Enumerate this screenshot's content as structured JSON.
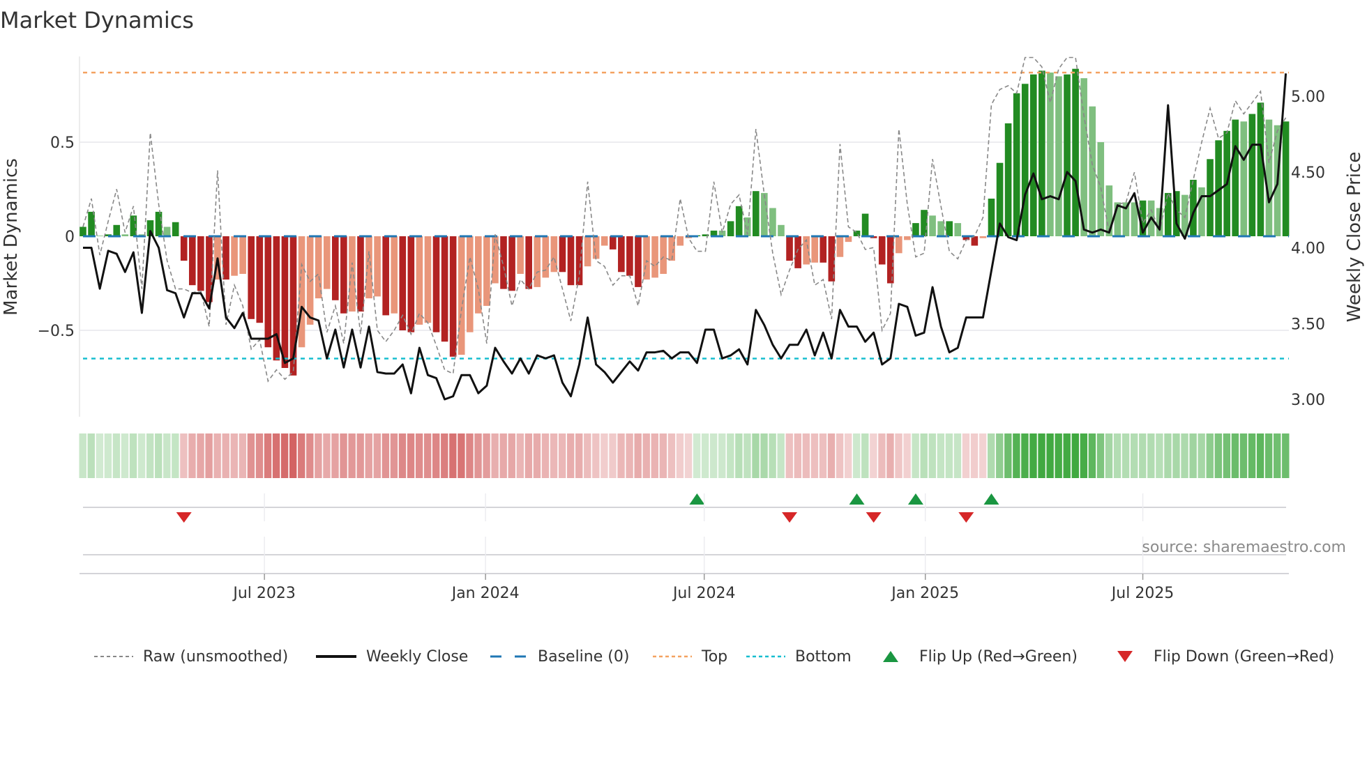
{
  "chart_data": {
    "type": "bar",
    "title": "Market Dynamics",
    "ylabel": "Market Dynamics",
    "y2label": "Weekly Close Price",
    "ylim": [
      -0.955,
      0.955
    ],
    "y2lim": [
      2.9,
      5.25
    ],
    "yticks": [
      {
        "v": 0.5,
        "label": "0.5"
      },
      {
        "v": 0,
        "label": "0"
      },
      {
        "v": -0.5,
        "label": "−0.5"
      }
    ],
    "y2ticks": [
      {
        "v": 5.0,
        "label": "5.00"
      },
      {
        "v": 4.5,
        "label": "4.50"
      },
      {
        "v": 4.0,
        "label": "4.00"
      },
      {
        "v": 3.5,
        "label": "3.50"
      },
      {
        "v": 3.0,
        "label": "3.00"
      }
    ],
    "xticks": [
      {
        "date": "2023-07-01",
        "label": "Jul 2023"
      },
      {
        "date": "2024-01-01",
        "label": "Jan 2024"
      },
      {
        "date": "2024-07-01",
        "label": "Jul 2024"
      },
      {
        "date": "2025-01-01",
        "label": "Jan 2025"
      },
      {
        "date": "2025-07-01",
        "label": "Jul 2025"
      }
    ],
    "start_date": "2023-01-31",
    "frequency": "weekly",
    "top_level": 0.87,
    "bottom_level": -0.65,
    "baseline": 0,
    "momentum": [
      0.05,
      0.13,
      0.003,
      0.01,
      0.06,
      0.01,
      0.11,
      0.01,
      0.085,
      0.13,
      0.05,
      0.075,
      -0.13,
      -0.26,
      -0.29,
      -0.35,
      -0.23,
      -0.23,
      -0.21,
      -0.2,
      -0.44,
      -0.46,
      -0.59,
      -0.66,
      -0.7,
      -0.74,
      -0.59,
      -0.47,
      -0.33,
      -0.28,
      -0.34,
      -0.41,
      -0.4,
      -0.4,
      -0.33,
      -0.32,
      -0.42,
      -0.41,
      -0.5,
      -0.51,
      -0.47,
      -0.46,
      -0.51,
      -0.56,
      -0.64,
      -0.63,
      -0.51,
      -0.41,
      -0.37,
      -0.25,
      -0.28,
      -0.29,
      -0.2,
      -0.28,
      -0.27,
      -0.22,
      -0.19,
      -0.19,
      -0.26,
      -0.26,
      -0.16,
      -0.12,
      -0.05,
      -0.07,
      -0.19,
      -0.21,
      -0.27,
      -0.23,
      -0.22,
      -0.2,
      -0.13,
      -0.05,
      -0.01,
      0.005,
      0.01,
      0.03,
      0.03,
      0.08,
      0.16,
      0.1,
      0.24,
      0.23,
      0.15,
      0.06,
      -0.13,
      -0.17,
      -0.15,
      -0.14,
      -0.14,
      -0.24,
      -0.11,
      -0.03,
      0.03,
      0.12,
      -0.01,
      -0.15,
      -0.25,
      -0.09,
      -0.02,
      0.07,
      0.14,
      0.11,
      0.08,
      0.08,
      0.07,
      -0.02,
      -0.05,
      -0.01,
      0.2,
      0.39,
      0.6,
      0.76,
      0.81,
      0.86,
      0.88,
      0.87,
      0.85,
      0.86,
      0.89,
      0.84,
      0.69,
      0.5,
      0.27,
      0.18,
      0.18,
      0.18,
      0.19,
      0.19,
      0.15,
      0.23,
      0.24,
      0.22,
      0.3,
      0.26,
      0.41,
      0.51,
      0.56,
      0.62,
      0.61,
      0.65,
      0.71,
      0.62,
      0.59,
      0.61
    ],
    "strong": [
      1,
      1,
      0,
      1,
      1,
      0,
      1,
      0,
      1,
      1,
      0,
      1,
      1,
      1,
      1,
      1,
      0,
      1,
      0,
      0,
      1,
      1,
      1,
      1,
      1,
      1,
      0,
      0,
      0,
      0,
      1,
      1,
      0,
      1,
      0,
      0,
      1,
      0,
      1,
      1,
      0,
      0,
      1,
      1,
      1,
      0,
      0,
      0,
      0,
      0,
      1,
      1,
      0,
      1,
      0,
      0,
      0,
      1,
      1,
      1,
      0,
      0,
      0,
      1,
      1,
      1,
      1,
      0,
      0,
      0,
      0,
      0,
      0,
      1,
      1,
      1,
      0,
      1,
      1,
      0,
      1,
      0,
      0,
      0,
      1,
      1,
      0,
      0,
      1,
      1,
      0,
      0,
      1,
      1,
      1,
      1,
      1,
      0,
      0,
      1,
      1,
      0,
      0,
      1,
      0,
      1,
      1,
      0,
      1,
      1,
      1,
      1,
      1,
      1,
      1,
      0,
      0,
      1,
      1,
      0,
      0,
      0,
      0,
      0,
      0,
      0,
      1,
      0,
      0,
      1,
      1,
      0,
      1,
      0,
      1,
      1,
      1,
      1,
      0,
      1,
      1,
      0,
      0,
      1
    ],
    "raw": [
      0.05,
      0.2,
      -0.1,
      0.08,
      0.25,
      0.02,
      0.16,
      -0.28,
      0.55,
      0.17,
      -0.13,
      -0.28,
      -0.28,
      -0.3,
      -0.29,
      -0.48,
      0.35,
      -0.47,
      -0.26,
      -0.37,
      -0.6,
      -0.55,
      -0.77,
      -0.71,
      -0.76,
      -0.72,
      -0.15,
      -0.24,
      -0.2,
      -0.51,
      -0.37,
      -0.57,
      -0.14,
      -0.52,
      -0.08,
      -0.5,
      -0.56,
      -0.5,
      -0.42,
      -0.52,
      -0.41,
      -0.46,
      -0.58,
      -0.71,
      -0.73,
      -0.39,
      -0.11,
      -0.28,
      -0.57,
      0.01,
      -0.16,
      -0.37,
      -0.23,
      -0.28,
      -0.19,
      -0.18,
      -0.11,
      -0.28,
      -0.45,
      -0.21,
      0.29,
      -0.13,
      -0.16,
      -0.26,
      -0.21,
      -0.21,
      -0.37,
      -0.13,
      -0.16,
      -0.11,
      -0.13,
      0.2,
      -0.01,
      -0.08,
      -0.08,
      0.29,
      0.02,
      0.17,
      0.22,
      0.01,
      0.57,
      0.22,
      -0.09,
      -0.31,
      -0.18,
      -0.07,
      -0.02,
      -0.26,
      -0.23,
      -0.44,
      0.49,
      0.05,
      0.02,
      -0.07,
      -0.06,
      -0.5,
      -0.41,
      0.57,
      0.17,
      -0.11,
      -0.09,
      0.41,
      0.16,
      -0.08,
      -0.12,
      -0.02,
      0.0,
      0.1,
      0.7,
      0.78,
      0.8,
      0.76,
      0.95,
      0.95,
      0.9,
      0.71,
      0.89,
      0.95,
      0.95,
      0.64,
      0.38,
      0.26,
      0.02,
      0.17,
      0.18,
      0.34,
      0.07,
      0.14,
      0.03,
      0.23,
      0.14,
      0.1,
      0.3,
      0.5,
      0.68,
      0.52,
      0.55,
      0.72,
      0.65,
      0.71,
      0.77,
      0.39,
      0.56,
      0.63
    ],
    "close": [
      4.0,
      4.0,
      3.73,
      3.98,
      3.96,
      3.84,
      3.97,
      3.57,
      4.11,
      4.0,
      3.72,
      3.7,
      3.54,
      3.7,
      3.7,
      3.6,
      3.93,
      3.54,
      3.47,
      3.57,
      3.4,
      3.4,
      3.4,
      3.43,
      3.24,
      3.27,
      3.61,
      3.54,
      3.52,
      3.27,
      3.46,
      3.21,
      3.46,
      3.21,
      3.48,
      3.18,
      3.17,
      3.17,
      3.23,
      3.04,
      3.34,
      3.16,
      3.14,
      3.0,
      3.02,
      3.16,
      3.16,
      3.04,
      3.09,
      3.34,
      3.25,
      3.17,
      3.27,
      3.17,
      3.29,
      3.27,
      3.29,
      3.11,
      3.02,
      3.23,
      3.54,
      3.23,
      3.18,
      3.11,
      3.18,
      3.25,
      3.19,
      3.31,
      3.31,
      3.32,
      3.27,
      3.31,
      3.31,
      3.24,
      3.46,
      3.46,
      3.27,
      3.29,
      3.33,
      3.23,
      3.59,
      3.49,
      3.36,
      3.27,
      3.36,
      3.36,
      3.46,
      3.29,
      3.44,
      3.27,
      3.59,
      3.48,
      3.48,
      3.38,
      3.44,
      3.23,
      3.27,
      3.63,
      3.61,
      3.42,
      3.44,
      3.74,
      3.48,
      3.31,
      3.34,
      3.54,
      3.54,
      3.54,
      3.85,
      4.16,
      4.07,
      4.05,
      4.35,
      4.49,
      4.32,
      4.34,
      4.32,
      4.5,
      4.44,
      4.12,
      4.1,
      4.12,
      4.1,
      4.28,
      4.26,
      4.36,
      4.1,
      4.2,
      4.12,
      4.94,
      4.16,
      4.06,
      4.23,
      4.34,
      4.34,
      4.38,
      4.42,
      4.67,
      4.58,
      4.68,
      4.68,
      4.3,
      4.42,
      5.15
    ],
    "flip_up_weeks": [
      74,
      93,
      100,
      109
    ],
    "flip_down_weeks": [
      13,
      85,
      95,
      106
    ],
    "legend": [
      {
        "label": "Raw (unsmoothed)"
      },
      {
        "label": "Weekly Close"
      },
      {
        "label": "Baseline (0)"
      },
      {
        "label": "Top"
      },
      {
        "label": "Bottom"
      },
      {
        "label": "Flip Up (Red→Green)"
      },
      {
        "label": "Flip Down (Green→Red)"
      }
    ],
    "legend_placement": "bottom",
    "source": "source: sharemaestro.com"
  },
  "colors": {
    "strong_up": "#228b22",
    "weak_up": "#7fbf7f",
    "strong_down": "#b22222",
    "weak_down": "#e9967a",
    "baseline": "#1f77b4",
    "top": "#f4a261",
    "bottom": "#17becf",
    "raw": "#888888",
    "close": "#111111",
    "flip_up": "#1a9641",
    "flip_down": "#d62728"
  }
}
